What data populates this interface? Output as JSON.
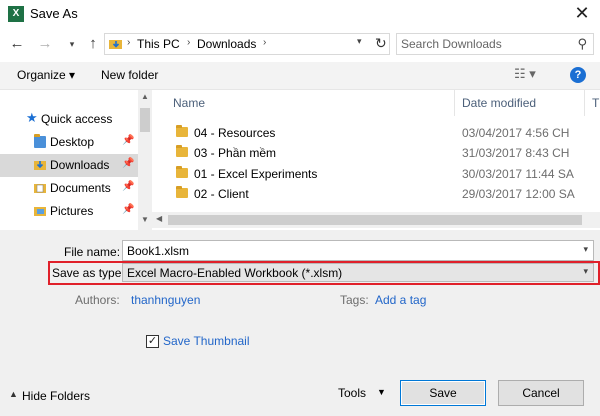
{
  "window": {
    "title": "Save As",
    "app_icon_text": "X",
    "close_glyph": "✕"
  },
  "nav": {
    "back_glyph": "←",
    "forward_glyph": "→",
    "recent_glyph": "▾",
    "up_glyph": "↑"
  },
  "address": {
    "segments": [
      "This PC",
      "Downloads"
    ],
    "separator": "›",
    "dropdown_glyph": "▾",
    "refresh_glyph": "↻"
  },
  "search": {
    "placeholder": "Search Downloads",
    "icon_glyph": "⚲"
  },
  "toolbar": {
    "organize_label": "Organize ▾",
    "new_folder_label": "New folder",
    "view_glyph": "☷ ▾",
    "help_glyph": "?"
  },
  "sidebar": {
    "items": [
      {
        "label": "Quick access",
        "icon": "star-icon",
        "glyph": "★"
      },
      {
        "label": "Desktop",
        "icon": "desktop-folder-icon"
      },
      {
        "label": "Downloads",
        "icon": "downloads-folder-icon",
        "selected": true
      },
      {
        "label": "Documents",
        "icon": "documents-folder-icon"
      },
      {
        "label": "Pictures",
        "icon": "pictures-folder-icon"
      }
    ],
    "pin_glyph": "📌"
  },
  "files": {
    "columns": {
      "name": "Name",
      "date": "Date modified",
      "type": "T"
    },
    "rows": [
      {
        "name": "04 - Resources",
        "date": "03/04/2017 4:56 CH"
      },
      {
        "name": "03 - Phần mềm",
        "date": "31/03/2017 8:43 CH"
      },
      {
        "name": "01 - Excel Experiments",
        "date": "30/03/2017 11:44 SA"
      },
      {
        "name": "02 - Client",
        "date": "29/03/2017 12:00 SA"
      }
    ]
  },
  "form": {
    "file_name_label": "File name:",
    "file_name_value": "Book1.xlsm",
    "save_type_label": "Save as type:",
    "save_type_value": "Excel Macro-Enabled Workbook (*.xlsm)",
    "authors_label": "Authors:",
    "authors_value": "thanhnguyen",
    "tags_label": "Tags:",
    "tags_value": "Add a tag",
    "thumbnail_label": "Save Thumbnail",
    "thumbnail_checked": true,
    "check_glyph": "✓"
  },
  "footer": {
    "hide_folders_label": "Hide Folders",
    "hide_folders_glyph": "▲",
    "tools_label": "Tools",
    "tools_glyph": "▼",
    "save_label": "Save",
    "cancel_label": "Cancel"
  },
  "colors": {
    "highlight": "#e0202a",
    "link": "#2266c9",
    "accent": "#0078d7",
    "folder": "#e8b53a"
  }
}
